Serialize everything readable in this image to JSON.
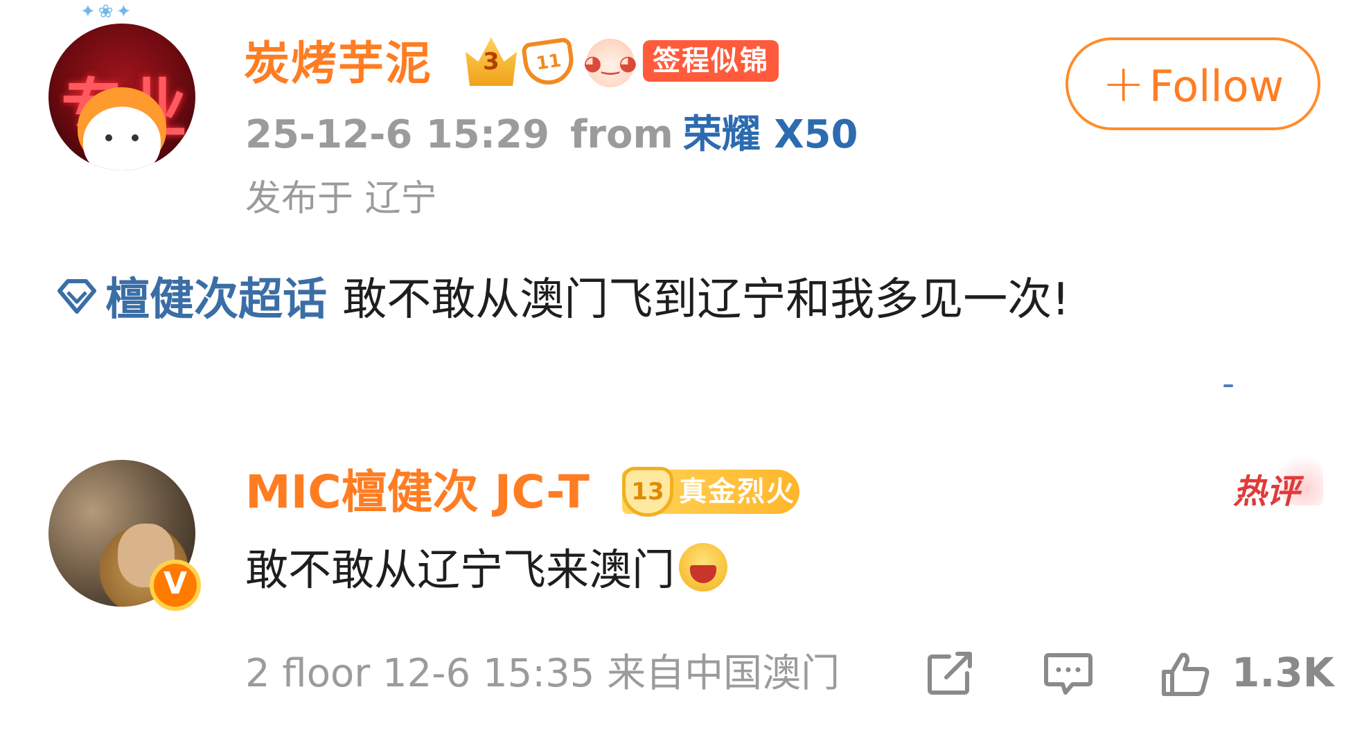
{
  "post": {
    "username": "炭烤芋泥",
    "badges": [
      "crown-level-badge",
      "diamond-level-badge",
      "mascot-badge"
    ],
    "crown_level": "3",
    "diamond_level": "11",
    "tag_label": "签程似锦",
    "timestamp": "25-12-6 15:29",
    "from_label": "from",
    "device": "荣耀 X50",
    "location": "发布于 辽宁",
    "follow_label": "Follow",
    "follow_plus": "+",
    "topic": "檀健次超话",
    "body": "敢不敢从澳门飞到辽宁和我多见一次!"
  },
  "comment": {
    "username": "MIC檀健次 JC-T",
    "level": "13",
    "level_title": "真金烈火",
    "verified": "V",
    "hot_label": "热评",
    "text": "敢不敢从辽宁飞来澳门",
    "floor_info": "2 floor 12-6 15:35 来自中国澳门",
    "like_count": "1.3K"
  },
  "colors": {
    "accent_orange": "#ff7d22",
    "link_blue": "#3a6ea5",
    "meta_gray": "#9b9b9b",
    "hot_red": "#e03a3a"
  }
}
